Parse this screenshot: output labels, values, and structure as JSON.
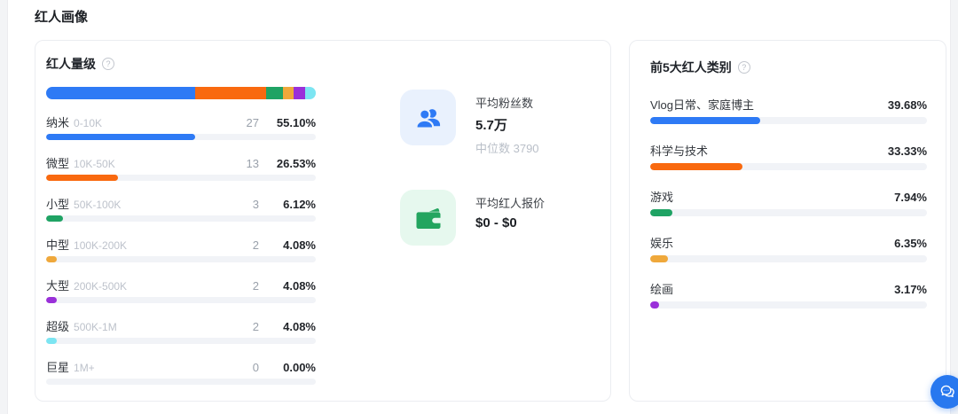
{
  "page": {
    "title": "红人画像"
  },
  "colors": {
    "blue": "#2e7af5",
    "orange": "#f9690f",
    "green": "#1fa364",
    "amber": "#efa83b",
    "purple": "#9a30d9",
    "cyan": "#7ce5f2",
    "track": "#f1f3f7",
    "fab": "#2878ef"
  },
  "tier_card": {
    "title": "红人量级",
    "help": "?",
    "stacked": [
      {
        "label": "纳米",
        "value": 55.1,
        "color": "#2e7af5"
      },
      {
        "label": "微型",
        "value": 26.53,
        "color": "#f9690f"
      },
      {
        "label": "小型",
        "value": 6.12,
        "color": "#1fa364"
      },
      {
        "label": "中型",
        "value": 4.08,
        "color": "#efa83b"
      },
      {
        "label": "大型",
        "value": 4.08,
        "color": "#9a30d9"
      },
      {
        "label": "超级",
        "value": 4.08,
        "color": "#7ce5f2"
      }
    ],
    "rows": [
      {
        "name": "纳米",
        "range": "0-10K",
        "count": "27",
        "percent": "55.10%",
        "value": 55.1,
        "color": "#2e7af5"
      },
      {
        "name": "微型",
        "range": "10K-50K",
        "count": "13",
        "percent": "26.53%",
        "value": 26.53,
        "color": "#f9690f"
      },
      {
        "name": "小型",
        "range": "50K-100K",
        "count": "3",
        "percent": "6.12%",
        "value": 6.12,
        "color": "#1fa364"
      },
      {
        "name": "中型",
        "range": "100K-200K",
        "count": "2",
        "percent": "4.08%",
        "value": 4.08,
        "color": "#efa83b"
      },
      {
        "name": "大型",
        "range": "200K-500K",
        "count": "2",
        "percent": "4.08%",
        "value": 4.08,
        "color": "#9a30d9"
      },
      {
        "name": "超级",
        "range": "500K-1M",
        "count": "2",
        "percent": "4.08%",
        "value": 4.08,
        "color": "#7ce5f2"
      },
      {
        "name": "巨星",
        "range": "1M+",
        "count": "0",
        "percent": "0.00%",
        "value": 0,
        "color": "transparent"
      }
    ],
    "stats": [
      {
        "icon": "users-icon",
        "label": "平均粉丝数",
        "value": "5.7万",
        "sub": "中位数 3790"
      },
      {
        "icon": "wallet-icon",
        "label": "平均红人报价",
        "value": "$0 - $0",
        "sub": ""
      }
    ]
  },
  "category_card": {
    "title": "前5大红人类别",
    "help": "?",
    "rows": [
      {
        "name": "Vlog日常、家庭博主",
        "percent": "39.68%",
        "value": 39.68,
        "color": "#2e7af5"
      },
      {
        "name": "科学与技术",
        "percent": "33.33%",
        "value": 33.33,
        "color": "#f9690f"
      },
      {
        "name": "游戏",
        "percent": "7.94%",
        "value": 7.94,
        "color": "#1fa364"
      },
      {
        "name": "娱乐",
        "percent": "6.35%",
        "value": 6.35,
        "color": "#efa83b"
      },
      {
        "name": "绘画",
        "percent": "3.17%",
        "value": 3.17,
        "color": "#9a30d9"
      }
    ]
  },
  "chat_button": {
    "icon": "chat-bubble-icon"
  }
}
